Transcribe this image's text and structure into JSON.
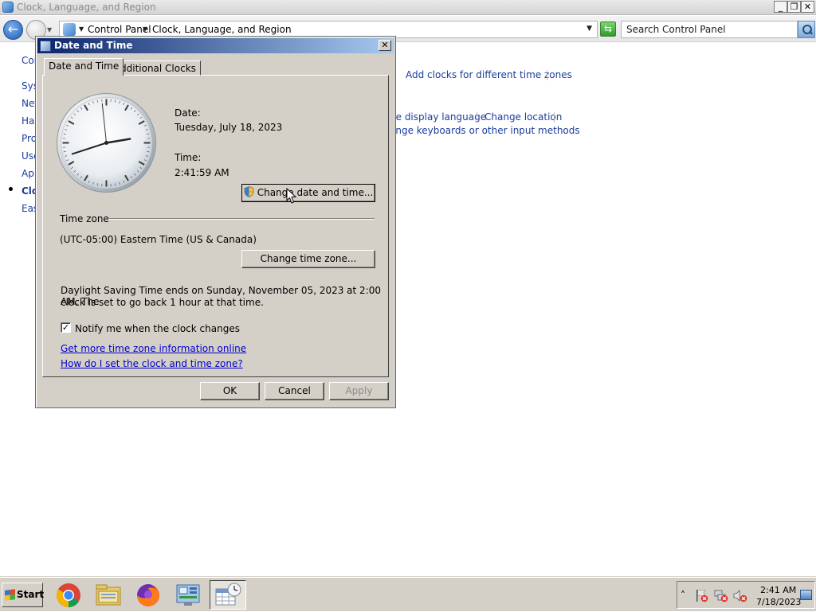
{
  "window": {
    "title": "Clock, Language, and Region",
    "btn_min": "_",
    "btn_max": "❐",
    "btn_close": "✕"
  },
  "nav": {
    "back_glyph": "←",
    "breadcrumbs": [
      "Control Panel",
      "Clock, Language, and Region"
    ],
    "search_placeholder": "Search Control Panel",
    "refresh_glyph": "⇆"
  },
  "background": {
    "sidebar": [
      "Cor",
      "Sys",
      "Net",
      "Har",
      "Pro",
      "Use",
      "App",
      "Clo",
      "Eas"
    ],
    "links": {
      "add_clocks": "Add clocks for different time zones",
      "display_language": "ge display language",
      "change_location": "Change location",
      "keyboards": "ange keyboards or other input methods"
    }
  },
  "dialog": {
    "title": "Date and Time",
    "close_glyph": "✕",
    "tabs": [
      "Date and Time",
      "Additional Clocks"
    ],
    "date_label": "Date:",
    "date_value": "Tuesday, July 18, 2023",
    "time_label": "Time:",
    "time_value": "2:41:59 AM",
    "clock_time": {
      "hours": 2,
      "minutes": 41,
      "seconds": 59
    },
    "change_date_button": "Change date and time...",
    "timezone_header": "Time zone",
    "timezone_value": "(UTC-05:00) Eastern Time (US & Canada)",
    "change_tz_button": "Change time zone...",
    "dst_line1": "Daylight Saving Time ends on Sunday, November 05, 2023 at 2:00 AM. The",
    "dst_line2": "clock is set to go back 1 hour at that time.",
    "notify_label": "Notify me when the clock changes",
    "notify_checked": true,
    "check_glyph": "✓",
    "link_more_info": "Get more time zone information online",
    "link_how_to": "How do I set the clock and time zone?",
    "ok": "OK",
    "cancel": "Cancel",
    "apply": "Apply"
  },
  "taskbar": {
    "start": "Start",
    "apps": [
      "chrome-icon",
      "file-explorer-icon",
      "firefox-icon",
      "control-panel-icon",
      "date-time-icon"
    ],
    "tray_expand": "˄",
    "time": "2:41 AM",
    "date": "7/18/2023"
  }
}
